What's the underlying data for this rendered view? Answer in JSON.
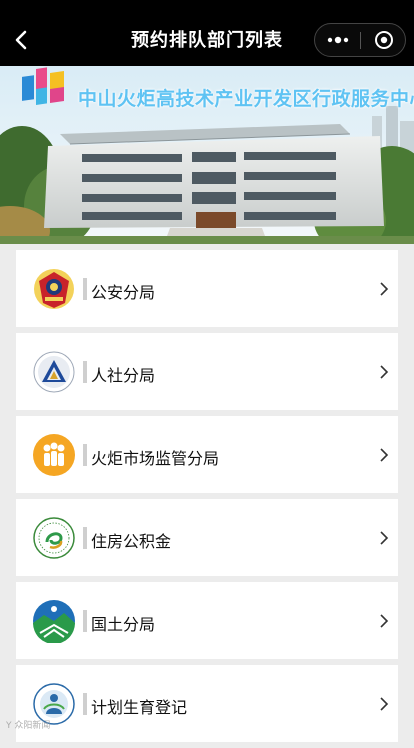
{
  "nav": {
    "title": "预约排队部门列表",
    "back_icon": "back-arrow-icon",
    "more_icon": "more-dots-icon",
    "close_icon": "target-circle-icon"
  },
  "banner": {
    "title": "中山火炬高技术产业开发区行政服务中心"
  },
  "departments": [
    {
      "label": "公安分局",
      "icon": "police-emblem-icon"
    },
    {
      "label": "人社分局",
      "icon": "social-security-emblem-icon"
    },
    {
      "label": "火炬市场监管分局",
      "icon": "market-supervision-icon"
    },
    {
      "label": "住房公积金",
      "icon": "housing-fund-icon"
    },
    {
      "label": "国土分局",
      "icon": "land-resources-icon"
    },
    {
      "label": "计划生育登记",
      "icon": "family-planning-icon"
    }
  ],
  "watermark": "Y 众阳新闻",
  "colors": {
    "nav_bg": "#000000",
    "page_bg": "#ececec",
    "accent_orange": "#f5a623",
    "banner_text": "#5fc3f3"
  }
}
